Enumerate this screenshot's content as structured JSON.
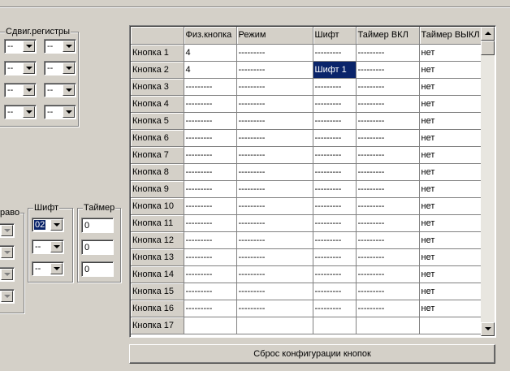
{
  "shift_registers": {
    "legend": "Сдвиг.регистры",
    "rows": [
      [
        "--",
        "--"
      ],
      [
        "--",
        "--"
      ],
      [
        "--",
        "--"
      ],
      [
        "--",
        "--"
      ]
    ]
  },
  "right_group": {
    "legend": "раво"
  },
  "shift_group": {
    "legend": "Шифт",
    "values": [
      "02",
      "--",
      "--"
    ]
  },
  "timer_group": {
    "legend": "Таймер",
    "values": [
      "0",
      "0",
      "0"
    ]
  },
  "grid": {
    "columns": [
      "",
      "Физ.кнопка",
      "Режим",
      "Шифт",
      "Таймер ВКЛ",
      "Таймер ВЫКЛ"
    ],
    "rows": [
      [
        "Кнопка 1",
        "4",
        "---------",
        "---------",
        "---------",
        "нет"
      ],
      [
        "Кнопка 2",
        "4",
        "---------",
        "Шифт 1",
        "---------",
        "нет"
      ],
      [
        "Кнопка 3",
        "---------",
        "---------",
        "---------",
        "---------",
        "нет"
      ],
      [
        "Кнопка 4",
        "---------",
        "---------",
        "---------",
        "---------",
        "нет"
      ],
      [
        "Кнопка 5",
        "---------",
        "---------",
        "---------",
        "---------",
        "нет"
      ],
      [
        "Кнопка 6",
        "---------",
        "---------",
        "---------",
        "---------",
        "нет"
      ],
      [
        "Кнопка 7",
        "---------",
        "---------",
        "---------",
        "---------",
        "нет"
      ],
      [
        "Кнопка 8",
        "---------",
        "---------",
        "---------",
        "---------",
        "нет"
      ],
      [
        "Кнопка 9",
        "---------",
        "---------",
        "---------",
        "---------",
        "нет"
      ],
      [
        "Кнопка 10",
        "---------",
        "---------",
        "---------",
        "---------",
        "нет"
      ],
      [
        "Кнопка 11",
        "---------",
        "---------",
        "---------",
        "---------",
        "нет"
      ],
      [
        "Кнопка 12",
        "---------",
        "---------",
        "---------",
        "---------",
        "нет"
      ],
      [
        "Кнопка 13",
        "---------",
        "---------",
        "---------",
        "---------",
        "нет"
      ],
      [
        "Кнопка 14",
        "---------",
        "---------",
        "---------",
        "---------",
        "нет"
      ],
      [
        "Кнопка 15",
        "---------",
        "---------",
        "---------",
        "---------",
        "нет"
      ],
      [
        "Кнопка 16",
        "---------",
        "---------",
        "---------",
        "---------",
        "нет"
      ],
      [
        "Кнопка 17",
        "",
        "",
        "",
        "",
        ""
      ]
    ],
    "selected_cell": {
      "row": 1,
      "col": 3
    }
  },
  "reset_button": {
    "label": "Сброс конфигурации кнопок"
  },
  "colors": {
    "face": "#d4d0c8",
    "highlight": "#0a246a",
    "shadow": "#808080"
  },
  "icons": {
    "dropdown": "chevron-down-icon",
    "scroll_up": "arrow-up-icon",
    "scroll_down": "arrow-down-icon"
  }
}
